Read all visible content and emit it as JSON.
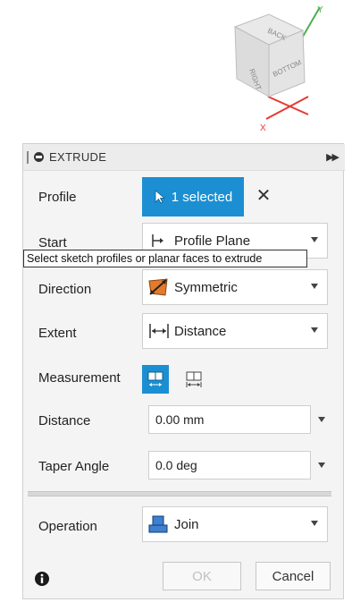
{
  "viewcube": {
    "faces": [
      "BACK",
      "RIGHT",
      "BOTTOM"
    ],
    "axes": [
      "Y",
      "X"
    ],
    "colors": {
      "y_axis": "#4caf50",
      "x_axis": "#e53935"
    }
  },
  "panel": {
    "title": "EXTRUDE",
    "rows": {
      "profile": {
        "label": "Profile",
        "selection": "1 selected"
      },
      "start": {
        "label": "Start",
        "value": "Profile Plane"
      },
      "direction": {
        "label": "Direction",
        "value": "Symmetric"
      },
      "extent": {
        "label": "Extent",
        "value": "Distance"
      },
      "measurement": {
        "label": "Measurement"
      },
      "distance": {
        "label": "Distance",
        "value": "0.00 mm"
      },
      "taper": {
        "label": "Taper Angle",
        "value": "0.0 deg"
      },
      "operation": {
        "label": "Operation",
        "value": "Join"
      }
    },
    "tooltip": "Select sketch profiles or planar faces to extrude",
    "footer": {
      "ok_label": "OK",
      "cancel_label": "Cancel"
    }
  },
  "colors": {
    "accent": "#1b8fd2",
    "panel_bg": "#f4f4f4",
    "header_bg": "#ececec",
    "disabled_text": "#c0c0c0"
  }
}
